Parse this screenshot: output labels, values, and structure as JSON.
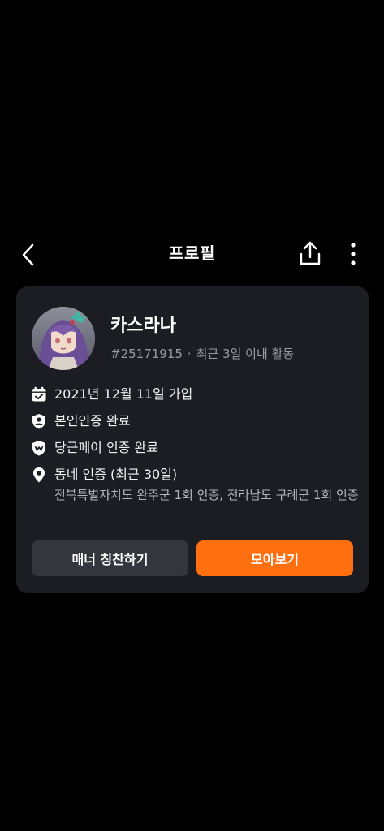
{
  "header": {
    "title": "프로필"
  },
  "profile": {
    "nickname": "카스라나",
    "user_id": "#25171915",
    "separator": "·",
    "activity": "최근 3일 이내 활동"
  },
  "info": {
    "joined": "2021년 12월 11일 가입",
    "identity": "본인인증 완료",
    "pay": "당근페이 인증 완료",
    "neighborhood": "동네 인증 (최근 30일)",
    "neighborhood_detail": "전북특별자치도 완주군 1회 인증, 전라남도 구례군 1회 인증"
  },
  "buttons": {
    "manner": "매너 칭찬하기",
    "view_all": "모아보기"
  },
  "colors": {
    "background": "#000000",
    "card": "#1c1d22",
    "accent": "#ff6f0f",
    "secondary_button": "#34363d",
    "muted_text": "#9a9ca3"
  },
  "icons": {
    "back": "chevron-left-icon",
    "share": "share-icon",
    "more": "more-vertical-icon",
    "calendar": "calendar-check-icon",
    "identity": "shield-person-icon",
    "pay": "pay-shield-icon",
    "location": "location-pin-icon"
  }
}
